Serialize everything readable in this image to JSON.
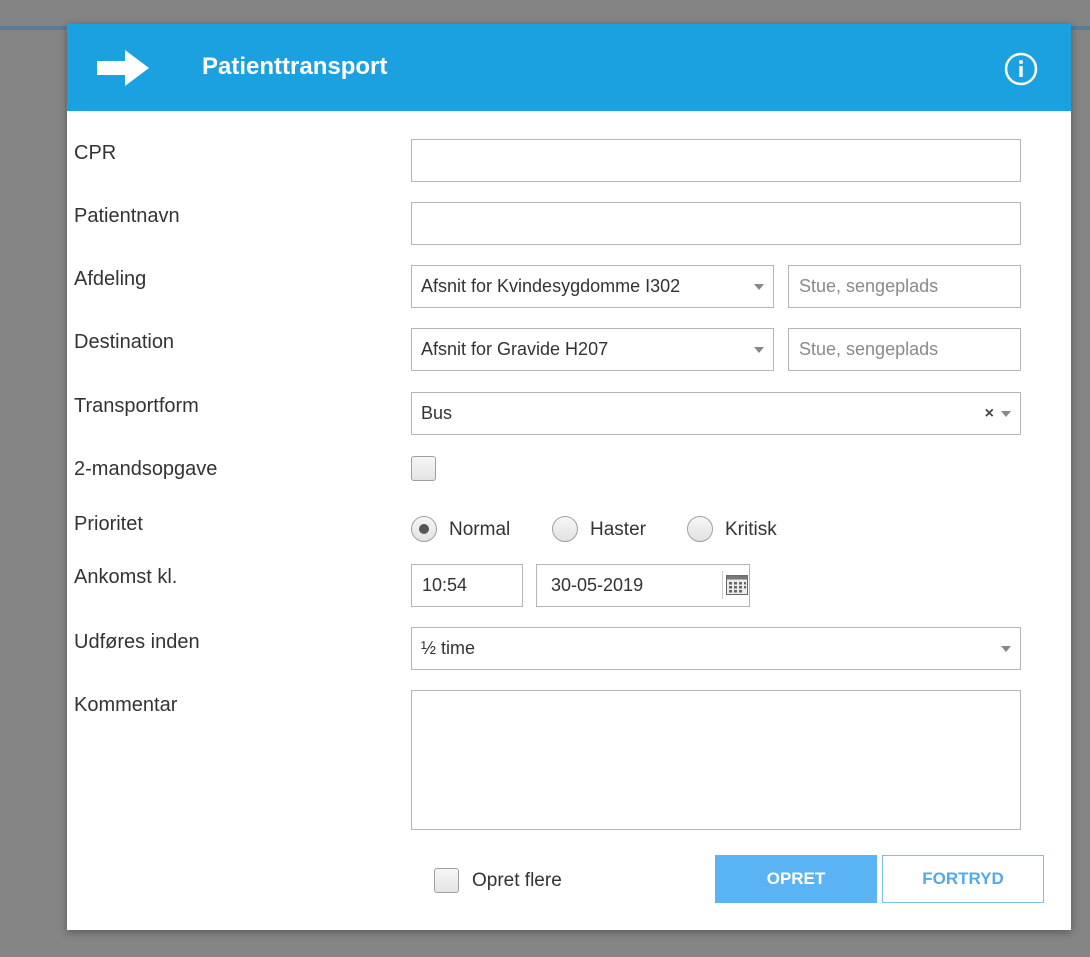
{
  "header": {
    "title": "Patienttransport",
    "arrow_icon": "arrow-right-icon",
    "info_icon": "info-icon"
  },
  "fields": {
    "cpr": {
      "label": "CPR",
      "value": ""
    },
    "patient_name": {
      "label": "Patientnavn",
      "value": ""
    },
    "department": {
      "label": "Afdeling",
      "value": "Afsnit for Kvindesygdomme I302",
      "room_placeholder": "Stue, sengeplads"
    },
    "destination": {
      "label": "Destination",
      "value": "Afsnit for Gravide H207",
      "room_placeholder": "Stue, sengeplads"
    },
    "transport_form": {
      "label": "Transportform",
      "value": "Bus",
      "clear": "×"
    },
    "two_person": {
      "label": "2-mandsopgave",
      "checked": false
    },
    "priority": {
      "label": "Prioritet",
      "options": [
        "Normal",
        "Haster",
        "Kritisk"
      ],
      "selected": "Normal"
    },
    "arrival": {
      "label": "Ankomst kl.",
      "time": "10:54",
      "date": "30-05-2019"
    },
    "execute_within": {
      "label": "Udføres inden",
      "value": "½ time"
    },
    "comment": {
      "label": "Kommentar",
      "value": ""
    }
  },
  "footer": {
    "create_multiple_label": "Opret flere",
    "create_label": "OPRET",
    "cancel_label": "FORTRYD"
  },
  "colors": {
    "header": "#1ca1e0",
    "primary_button": "#5ab4f3",
    "secondary_text": "#54a9e8"
  }
}
